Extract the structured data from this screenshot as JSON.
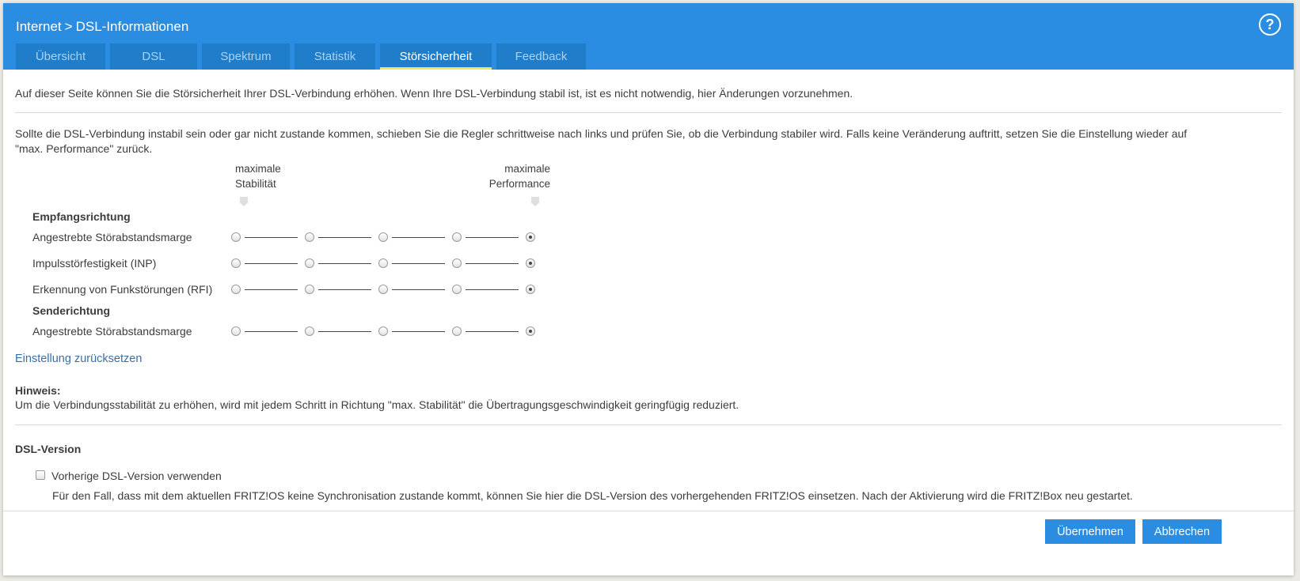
{
  "header": {
    "breadcrumb_root": "Internet",
    "breadcrumb_separator": ">",
    "breadcrumb_current": "DSL-Informationen",
    "help_label": "?",
    "accent_color": "#2a8de1"
  },
  "tabs": [
    {
      "label": "Übersicht",
      "active": false
    },
    {
      "label": "DSL",
      "active": false
    },
    {
      "label": "Spektrum",
      "active": false
    },
    {
      "label": "Statistik",
      "active": false
    },
    {
      "label": "Störsicherheit",
      "active": true
    },
    {
      "label": "Feedback",
      "active": false
    }
  ],
  "main": {
    "intro": "Auf dieser Seite können Sie die Störsicherheit Ihrer DSL-Verbindung erhöhen. Wenn Ihre DSL-Verbindung stabil ist, ist es nicht notwendig, hier Änderungen vorzunehmen.",
    "instructions_line1": "Sollte die DSL-Verbindung instabil sein oder gar nicht zustande kommen, schieben Sie die Regler schrittweise nach links und prüfen Sie, ob die Verbindung stabiler wird. Falls keine Veränderung auftritt, setzen Sie die Einstellung wieder auf",
    "instructions_line2": "\"max. Performance\" zurück.",
    "scale": {
      "left_line1": "maximale",
      "left_line2": "Stabilität",
      "right_line1": "maximale",
      "right_line2": "Performance"
    },
    "receive_heading": "Empfangsrichtung",
    "send_heading": "Senderichtung",
    "sliders": [
      {
        "label": "Angestrebte Störabstandsmarge",
        "steps": 5,
        "selected": 5
      },
      {
        "label": "Impulsstörfestigkeit (INP)",
        "steps": 5,
        "selected": 5
      },
      {
        "label": "Erkennung von Funkstörungen (RFI)",
        "steps": 5,
        "selected": 5
      },
      {
        "label": "Angestrebte Störabstandsmarge",
        "steps": 5,
        "selected": 5
      }
    ],
    "reset_link": "Einstellung zurücksetzen",
    "hint_title": "Hinweis:",
    "hint_text": "Um die Verbindungsstabilität zu erhöhen, wird mit jedem Schritt in Richtung \"max. Stabilität\" die Übertragungsgeschwindigkeit geringfügig reduziert.",
    "dsl_version_heading": "DSL-Version",
    "dsl_version_checkbox_label": "Vorherige DSL-Version verwenden",
    "dsl_version_checkbox_checked": false,
    "dsl_version_description": "Für den Fall, dass mit dem aktuellen FRITZ!OS keine Synchronisation zustande kommt, können Sie hier die DSL-Version des vorhergehenden FRITZ!OS einsetzen. Nach der Aktivierung wird die FRITZ!Box neu gestartet."
  },
  "footer": {
    "apply_label": "Übernehmen",
    "cancel_label": "Abbrechen"
  }
}
